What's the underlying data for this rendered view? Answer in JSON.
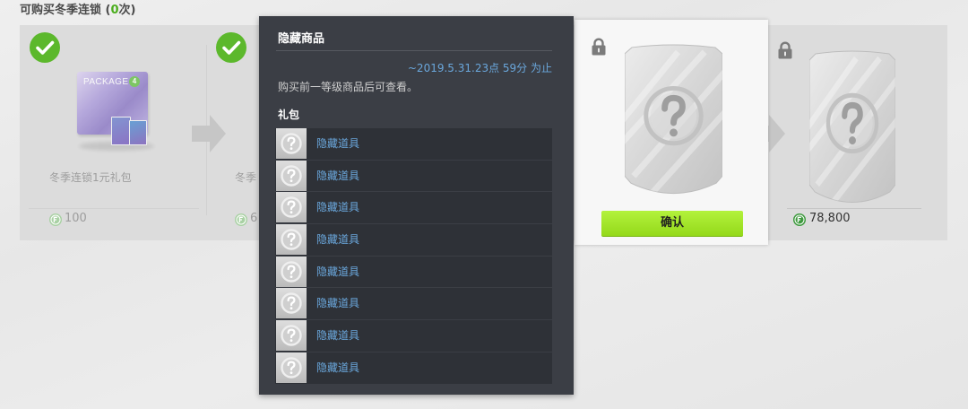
{
  "header": {
    "title_prefix": "可购买冬季连锁 (",
    "count": "0",
    "title_suffix": "次)"
  },
  "colors": {
    "count_green": "#4cae1e",
    "check_green": "#5cb82c",
    "confirm_green": "#9ee31c",
    "link_blue": "#6aa7dc",
    "tooltip_bg": "#3b3e45",
    "panel_bg": "#dcdcdc"
  },
  "chain": [
    {
      "name": "冬季连锁1元礼包",
      "price": "100",
      "status_icon": "check-icon",
      "currency_icon": "coin-icon",
      "package": {
        "label": "PACKAGE",
        "badge": "4"
      }
    },
    {
      "name": "冬季",
      "price": "6",
      "status_icon": "check-icon",
      "currency_icon": "coin-icon"
    },
    {
      "status_icon": "lock-icon",
      "image_icon": "hidden-card-icon",
      "confirm_label": "确认"
    },
    {
      "price": "78,800",
      "status_icon": "lock-icon",
      "image_icon": "hidden-card-icon",
      "currency_icon": "coin-icon"
    }
  ],
  "popup": {
    "title": "隐藏商品",
    "deadline": "~2019.5.31.23点 59分 为止",
    "note": "购买前一等级商品后可查看。",
    "section_label": "礼包",
    "items": [
      {
        "label": "隐藏道具",
        "icon": "question-icon"
      },
      {
        "label": "隐藏道具",
        "icon": "question-icon"
      },
      {
        "label": "隐藏道具",
        "icon": "question-icon"
      },
      {
        "label": "隐藏道具",
        "icon": "question-icon"
      },
      {
        "label": "隐藏道具",
        "icon": "question-icon"
      },
      {
        "label": "隐藏道具",
        "icon": "question-icon"
      },
      {
        "label": "隐藏道具",
        "icon": "question-icon"
      },
      {
        "label": "隐藏道具",
        "icon": "question-icon"
      }
    ]
  }
}
